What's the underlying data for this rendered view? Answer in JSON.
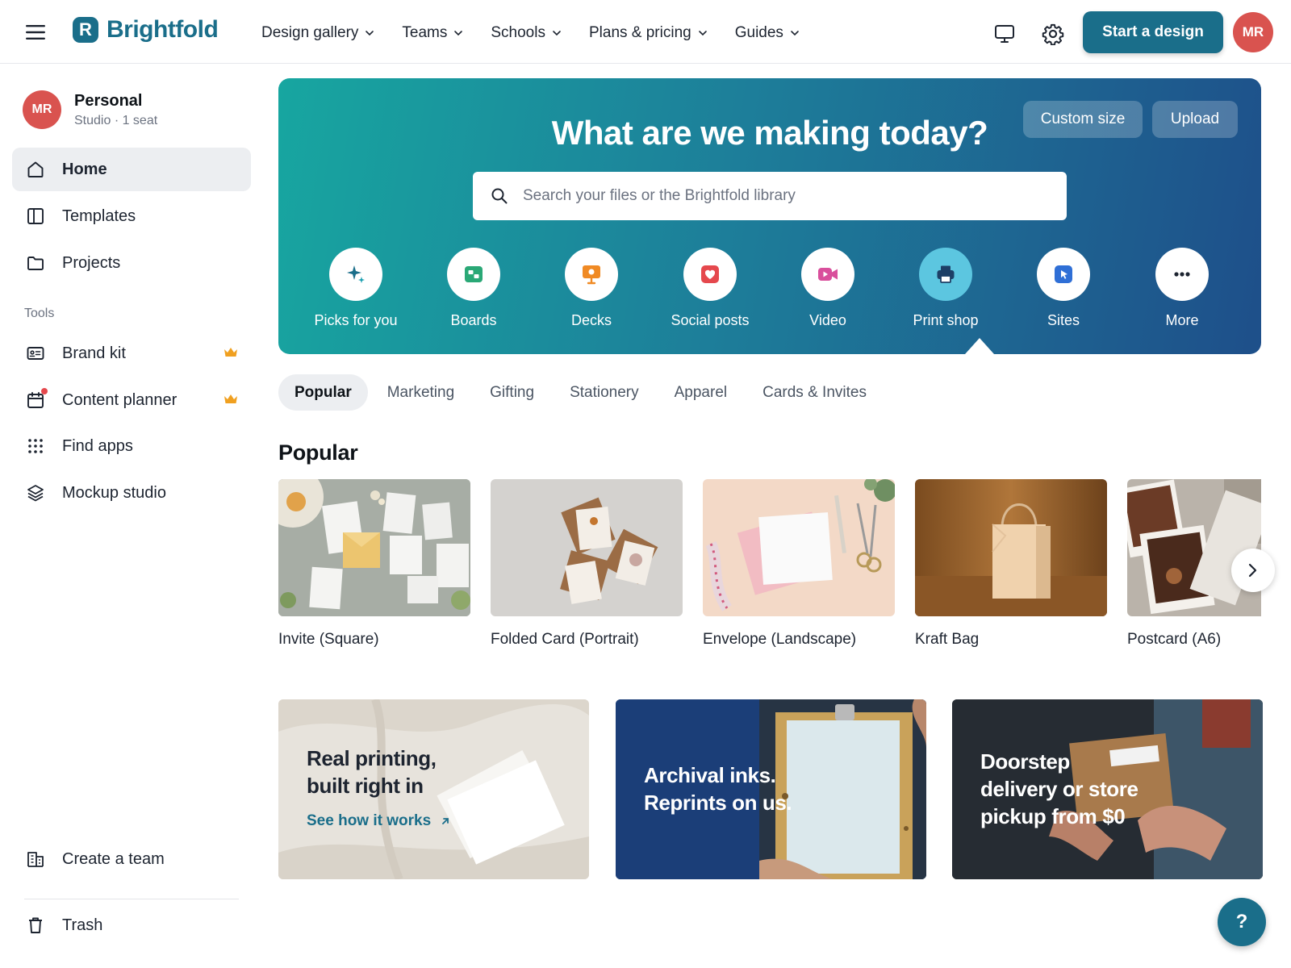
{
  "brand": {
    "mark": "R",
    "name": "Brightfold",
    "accent": "#1a6e8a"
  },
  "topnav": [
    {
      "label": "Design gallery"
    },
    {
      "label": "Teams"
    },
    {
      "label": "Schools"
    },
    {
      "label": "Plans & pricing"
    },
    {
      "label": "Guides"
    }
  ],
  "header": {
    "start_label": "Start a design",
    "avatar_initials": "MR",
    "icons": [
      "desktop-icon",
      "gear-icon"
    ]
  },
  "account": {
    "initials": "MR",
    "name": "Personal",
    "subtitle": "Studio · 1 seat"
  },
  "sidebar": {
    "main": [
      {
        "label": "Home",
        "icon": "home-icon",
        "active": true
      },
      {
        "label": "Templates",
        "icon": "templates-icon"
      },
      {
        "label": "Projects",
        "icon": "folder-icon"
      }
    ],
    "tools_label": "Tools",
    "tools": [
      {
        "label": "Brand kit",
        "icon": "brand-kit-icon",
        "premium": true
      },
      {
        "label": "Content planner",
        "icon": "calendar-icon",
        "premium": true
      },
      {
        "label": "Find apps",
        "icon": "apps-grid-icon"
      },
      {
        "label": "Mockup studio",
        "icon": "layers-icon"
      }
    ],
    "bottom": [
      {
        "label": "Create a team",
        "icon": "team-building-icon"
      },
      {
        "label": "Trash",
        "icon": "trash-icon"
      }
    ]
  },
  "hero": {
    "title": "What are we making today?",
    "custom_size_label": "Custom size",
    "upload_label": "Upload",
    "search_placeholder": "Search your files or the Brightfold library",
    "categories": [
      {
        "label": "Picks for you",
        "icon": "sparkle-icon"
      },
      {
        "label": "Boards",
        "icon": "board-icon"
      },
      {
        "label": "Decks",
        "icon": "presentation-icon"
      },
      {
        "label": "Social posts",
        "icon": "heart-icon"
      },
      {
        "label": "Video",
        "icon": "video-icon"
      },
      {
        "label": "Print shop",
        "icon": "printer-icon",
        "selected": true
      },
      {
        "label": "Sites",
        "icon": "cursor-icon"
      },
      {
        "label": "More",
        "icon": "more-icon"
      }
    ]
  },
  "filter_tabs": [
    {
      "label": "Popular",
      "active": true
    },
    {
      "label": "Marketing"
    },
    {
      "label": "Gifting"
    },
    {
      "label": "Stationery"
    },
    {
      "label": "Apparel"
    },
    {
      "label": "Cards & Invites"
    }
  ],
  "section_title": "Popular",
  "products": [
    {
      "label": "Invite (Square)"
    },
    {
      "label": "Folded Card (Portrait)"
    },
    {
      "label": "Envelope (Landscape)"
    },
    {
      "label": "Kraft Bag"
    },
    {
      "label": "Postcard (A6)"
    }
  ],
  "promos": [
    {
      "line1": "Real printing,",
      "line2": "built right in",
      "link": "See how it works"
    },
    {
      "line1": "Archival inks.",
      "line2": "Reprints on us."
    },
    {
      "line1": "Doorstep",
      "line2": "delivery or store",
      "line3": "pickup from $0"
    }
  ],
  "help_label": "?"
}
